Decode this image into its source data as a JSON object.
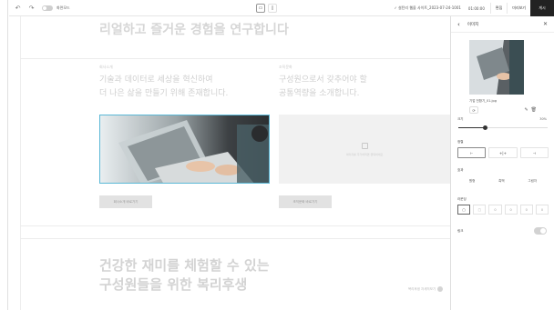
{
  "toolbar": {
    "mode_label": "화면모드",
    "site_name": "✓ 설탄리 웹을 사이트_2023-07-24-1001",
    "time": "01:00:00",
    "btn_settings": "편집",
    "btn_preview": "미리보기",
    "btn_publish": "게시",
    "undo_icon": "↶",
    "redo_icon": "↷",
    "desktop_icon": "▭",
    "mobile_icon": "▯"
  },
  "canvas": {
    "headline1": "리얼하고 즐거운 경험을 연구합니다",
    "left_col": {
      "label": "회사소개",
      "line1": "기술과 데이터로 세상을 혁신하여",
      "line2": "더 나은 삶을 만들기 위해 존재합니다.",
      "cta": "회사소개 바로가기"
    },
    "right_col": {
      "label": "조직문화",
      "line1": "구성원으로서 갖추어야 할",
      "line2": "공통역량을 소개합니다.",
      "placeholder": "이미지를 추가하려면 클릭하세요",
      "cta": "조직문화 바로가기"
    },
    "headline2_line1": "건강한 재미를 체험할 수 있는",
    "headline2_line2": "구성원들을 위한 복리후생",
    "more_link": "복리후생 자세히보기"
  },
  "panel": {
    "title": "이미지",
    "back_icon": "‹",
    "close_icon": "✕",
    "file_name": "기업 전환기_01.jpg",
    "size_label": "크기",
    "size_value": "30%",
    "size_fraction": 0.3,
    "align_label": "정렬",
    "align_options": [
      "⊢",
      "+|+",
      "⊣"
    ],
    "fit_label": "효과",
    "fit_options": [
      "원형",
      "흑백",
      "그림자"
    ],
    "radius_label": "라운딩",
    "radius_options": [
      "▢",
      "□",
      "0",
      "0",
      "0",
      "0"
    ],
    "link_label": "링크",
    "edit_icon": "✎",
    "delete_icon": "🗑"
  },
  "colors": {
    "selection": "#5ab8d6",
    "publish_bg": "#222222"
  }
}
